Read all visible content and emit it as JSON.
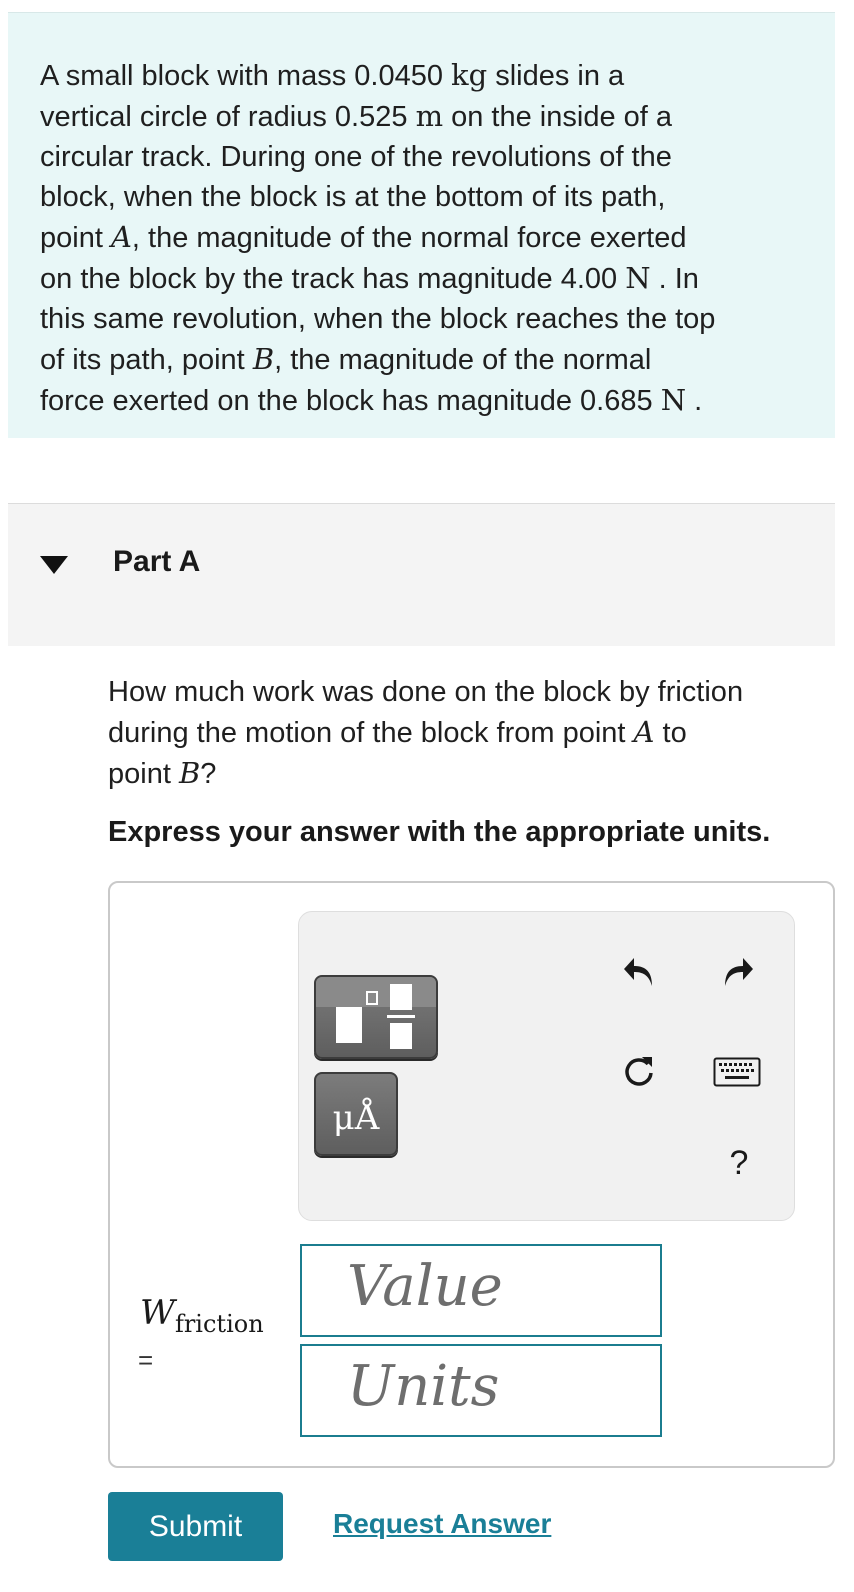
{
  "problem": {
    "lines": [
      [
        "A small block with mass 0.0450 ",
        "kg",
        " slides in a"
      ],
      [
        "vertical circle of radius 0.525 ",
        "m",
        " on the inside of a"
      ],
      [
        "circular track. During one of the revolutions of the"
      ],
      [
        "block, when the block is at the bottom of its path,"
      ],
      [
        "point ",
        "A",
        ", the magnitude of the normal force exerted"
      ],
      [
        "on the block by the track has magnitude 4.00 ",
        "N",
        " . In"
      ],
      [
        "this same revolution, when the block reaches the top"
      ],
      [
        "of its path, point ",
        "B",
        ", the magnitude of the normal"
      ],
      [
        "force exerted on the block has magnitude 0.685 ",
        "N",
        " ."
      ]
    ]
  },
  "part": {
    "title": "Part A"
  },
  "question": {
    "line1": "How much work was done on the block by friction",
    "line2_a": "during the motion of the block from point ",
    "line2_var": "A",
    "line2_b": " to",
    "line3_a": "point ",
    "line3_var": "B",
    "line3_b": "?",
    "instruction": "Express your answer with the appropriate units."
  },
  "toolbar": {
    "units_label": "μÅ",
    "help_label": "?",
    "icons": [
      "fraction-template-icon",
      "units-icon",
      "undo-icon",
      "redo-icon",
      "reset-icon",
      "keyboard-icon",
      "help-icon"
    ]
  },
  "answer": {
    "var_main": "W",
    "var_sub": "friction",
    "equals": "=",
    "value_placeholder": "Value",
    "units_placeholder": "Units"
  },
  "actions": {
    "submit_label": "Submit",
    "request_label": "Request Answer"
  },
  "colors": {
    "problem_bg": "#e8f7f7",
    "accent": "#1a7f97",
    "input_border": "#1b7d8f"
  }
}
